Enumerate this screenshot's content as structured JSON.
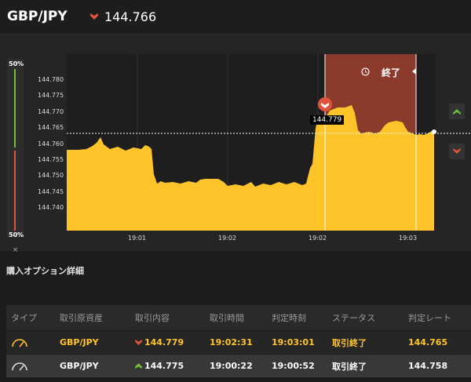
{
  "header": {
    "pair": "GBP/JPY",
    "price": "144.766"
  },
  "meter": {
    "top_label": "50%",
    "bottom_label": "50%",
    "close_label": "×"
  },
  "chart": {
    "y_ticks": [
      "144.780",
      "144.775",
      "144.770",
      "144.765",
      "144.760",
      "144.755",
      "144.750",
      "144.745",
      "144.740"
    ],
    "x_ticks": [
      "19:01",
      "19:02",
      "19:02",
      "19:03"
    ],
    "marker_price": "144.779",
    "end_label": "終了",
    "current_price": 144.766,
    "chart_data": {
      "type": "area",
      "x_range": [
        "19:00:22",
        "19:03:19"
      ],
      "ylim": [
        144.733,
        144.788
      ],
      "entry_price": 144.779,
      "entry_time": "19:02:31",
      "expiry_time": "19:03:01",
      "current_price": 144.766,
      "colors": {
        "area": "#ffc42a",
        "expired_zone": "#8b3a2b",
        "up": "#6fbf3a",
        "down": "#e0533d"
      }
    }
  },
  "section": {
    "title": "購入オプション詳細"
  },
  "table": {
    "headers": [
      "タイプ",
      "取引原資産",
      "取引内容",
      "取引時間",
      "判定時刻",
      "ステータス",
      "判定レート"
    ],
    "rows": [
      {
        "asset": "GBP/JPY",
        "direction": "down",
        "rate": "144.779",
        "time": "19:02:31",
        "judge_time": "19:03:01",
        "status": "取引終了",
        "judge_rate": "144.765"
      },
      {
        "asset": "GBP/JPY",
        "direction": "up",
        "rate": "144.775",
        "time": "19:00:22",
        "judge_time": "19:00:52",
        "status": "取引終了",
        "judge_rate": "144.758"
      }
    ]
  }
}
